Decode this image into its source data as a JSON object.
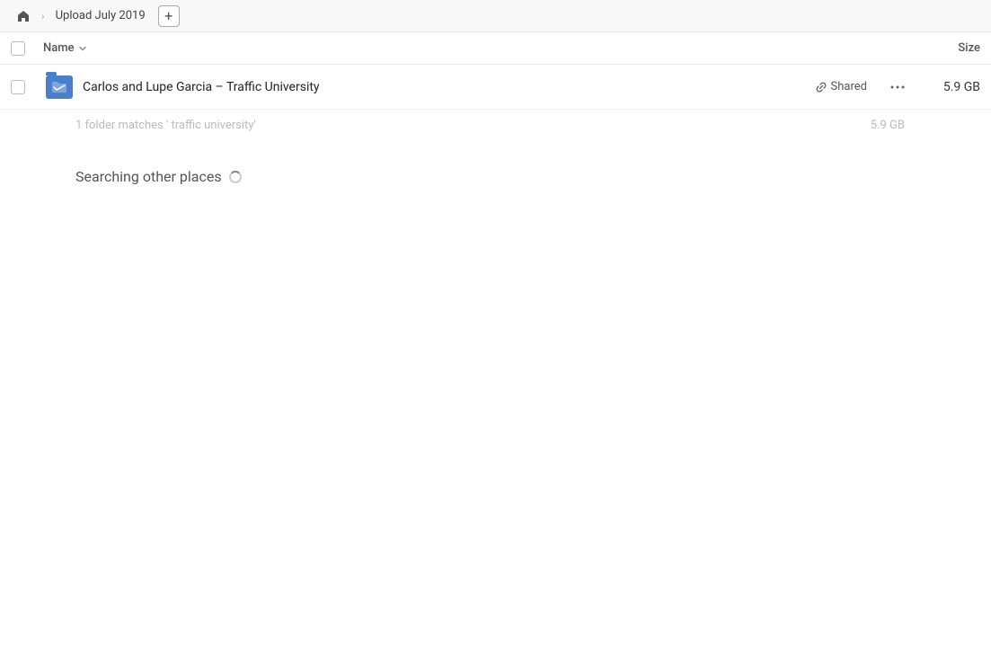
{
  "breadcrumb": {
    "home_label": "Home",
    "current_path": "Upload July 2019",
    "add_button_label": "+"
  },
  "columns": {
    "name_label": "Name",
    "size_label": "Size"
  },
  "file_row": {
    "name": "Carlos and Lupe Garcia – Traffic University",
    "shared_label": "Shared",
    "size": "5.9 GB",
    "more_label": "···"
  },
  "search_info": {
    "text": "1 folder matches ' traffic university'",
    "size": "5.9 GB"
  },
  "searching": {
    "label": "Searching other places"
  },
  "icons": {
    "home": "⌂",
    "chevron_right": "›",
    "link": "🔗",
    "more_dots": "···"
  }
}
